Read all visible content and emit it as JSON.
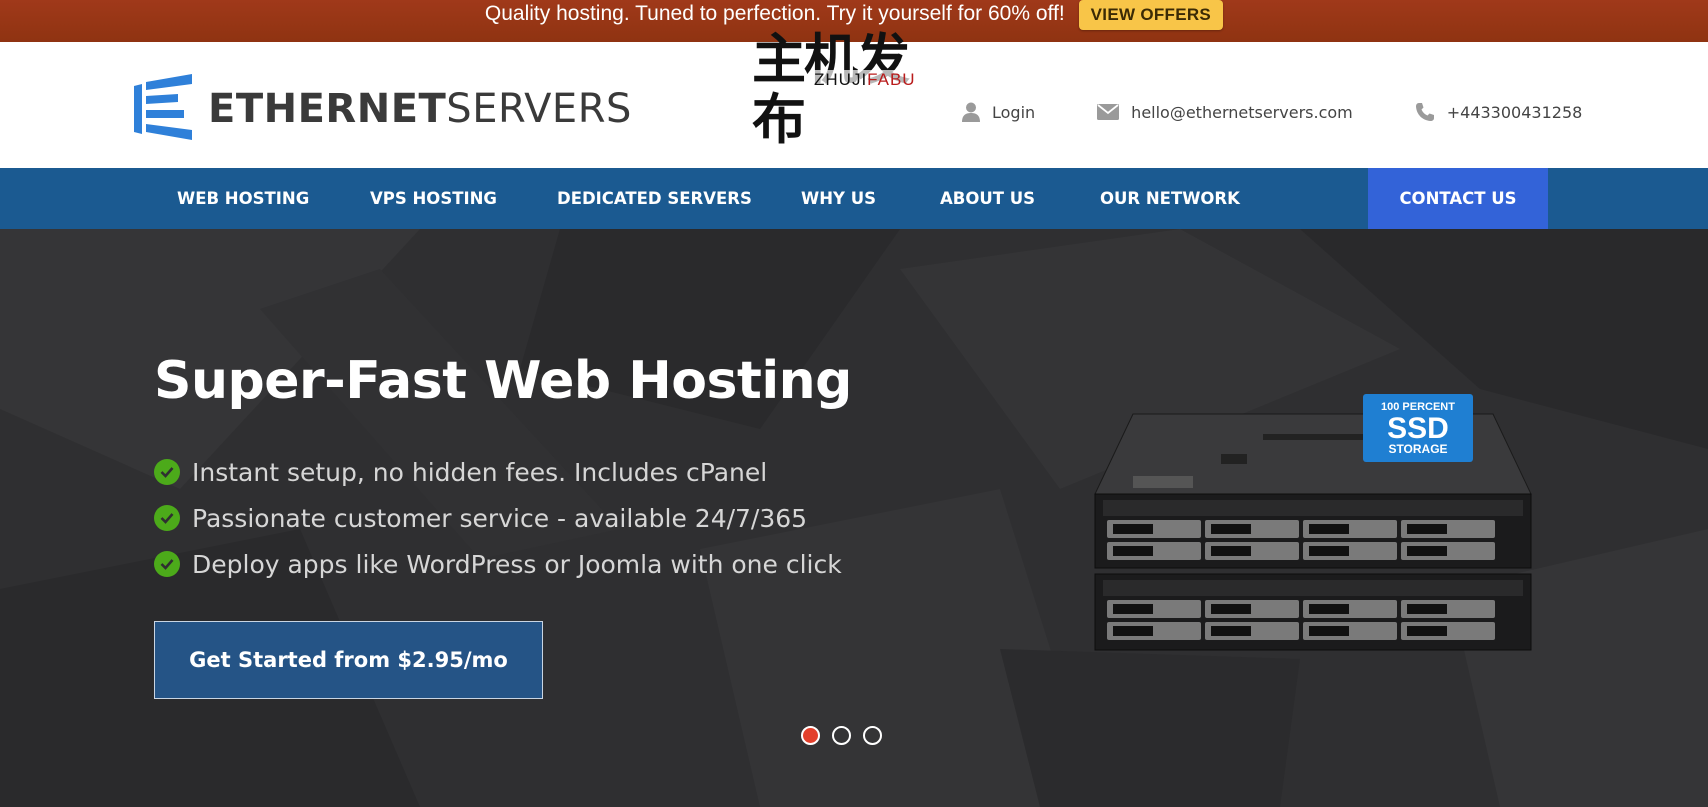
{
  "promo": {
    "text": "Quality hosting. Tuned to perfection. Try it yourself for 60% off!",
    "button": "VIEW OFFERS"
  },
  "header": {
    "logo_bold": "ETHERNET",
    "logo_light": "SERVERS",
    "watermark_cn": "主机发布",
    "watermark_en_black": "ZHUJI",
    "watermark_en_red": "FABU",
    "login": "Login",
    "email": "hello@ethernetservers.com",
    "phone": "+443300431258"
  },
  "nav": {
    "items": [
      "WEB HOSTING",
      "VPS HOSTING",
      "DEDICATED SERVERS",
      "WHY US",
      "ABOUT US",
      "OUR NETWORK"
    ],
    "contact": "CONTACT US"
  },
  "hero": {
    "title": "Super-Fast Web Hosting",
    "features": [
      "Instant setup, no hidden fees. Includes cPanel",
      "Passionate customer service - available 24/7/365",
      "Deploy apps like WordPress or Joomla with one click"
    ],
    "cta": "Get Started from $2.95/mo",
    "badge_top": "100 PERCENT",
    "badge_main": "SSD",
    "badge_bottom": "STORAGE",
    "slides_total": 3,
    "slide_active": 1
  },
  "colors": {
    "promo_bg": "#9a3412",
    "promo_button": "#f8c548",
    "nav_bg": "#1b5a91",
    "nav_contact_bg": "#3363d8",
    "hero_bg": "#2f2f31",
    "cta_bg": "#255486",
    "check_green": "#4caa1a",
    "dot_active": "#e3402c"
  }
}
